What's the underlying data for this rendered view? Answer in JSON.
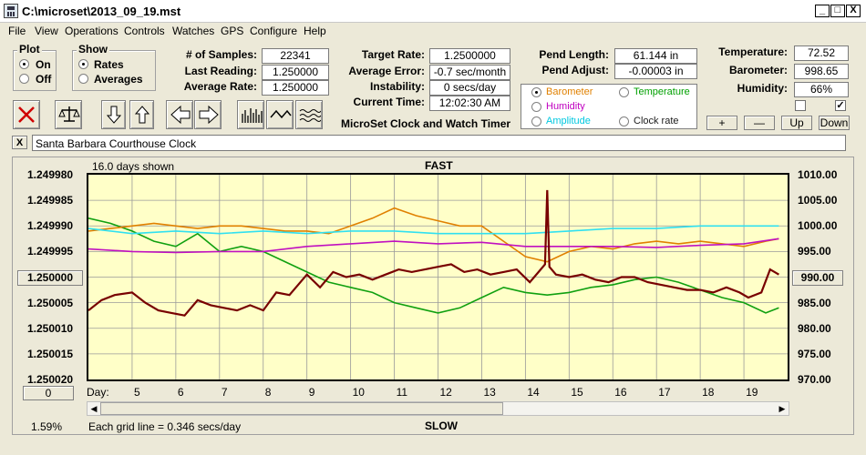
{
  "window": {
    "title": "C:\\microset\\2013_09_19.mst",
    "min": "_",
    "max": "□",
    "close": "X"
  },
  "menu": [
    "File",
    "View",
    "Operations",
    "Controls",
    "Watches",
    "GPS",
    "Configure",
    "Help"
  ],
  "plot_group": {
    "title": "Plot",
    "options": [
      "On",
      "Off"
    ],
    "selected": "On"
  },
  "show_group": {
    "title": "Show",
    "options": [
      "Rates",
      "Averages"
    ],
    "selected": "Rates"
  },
  "stats1": [
    {
      "label": "# of Samples:",
      "value": "22341"
    },
    {
      "label": "Last Reading:",
      "value": "1.250000"
    },
    {
      "label": "Average Rate:",
      "value": "1.250000"
    }
  ],
  "stats2": [
    {
      "label": "Target Rate:",
      "value": "1.2500000"
    },
    {
      "label": "Average Error:",
      "value": "-0.7 sec/month"
    },
    {
      "label": "Instability:",
      "value": "0 secs/day"
    },
    {
      "label": "Current Time:",
      "value": "12:02:30 AM"
    }
  ],
  "app_caption": "MicroSet Clock and Watch Timer",
  "stats3": [
    {
      "label": "Pend Length:",
      "value": "61.144 in"
    },
    {
      "label": "Pend Adjust:",
      "value": "-0.00003 in"
    }
  ],
  "stats4": [
    {
      "label": "Temperature:",
      "value": "72.52"
    },
    {
      "label": "Barometer:",
      "value": "998.65"
    },
    {
      "label": "Humidity:",
      "value": "66%"
    }
  ],
  "sensor_options": [
    {
      "label": "Barometer",
      "color": "#e08000",
      "selected": true
    },
    {
      "label": "Temperature",
      "color": "#00a000",
      "selected": false
    },
    {
      "label": "Humidity",
      "color": "#c000c0",
      "selected": false
    },
    {
      "label": "Clock rate",
      "color": "#202020",
      "selected": false
    },
    {
      "label": "Amplitude",
      "color": "#00c8e0",
      "selected": false
    }
  ],
  "axis_buttons": [
    "+",
    "—",
    "Up",
    "Down"
  ],
  "checkbox2": "✓",
  "watch_name": "Santa Barbara Courthouse Clock",
  "watch_close": "X",
  "chart_header": {
    "days_shown": "16.0 days shown",
    "top": "FAST",
    "bottom": "SLOW",
    "grid_note": "Each grid line = 0.346 secs/day",
    "percent": "1.59%",
    "day_label": "Day:",
    "center_left": "1.250000",
    "center_right": "990.00",
    "zero_btn": "0"
  },
  "chart_data": {
    "type": "line",
    "y_left_ticks": [
      "1.249980",
      "1.249985",
      "1.249990",
      "1.249995",
      "1.250000",
      "1.250005",
      "1.250010",
      "1.250015",
      "1.250020"
    ],
    "y_right_ticks": [
      "1010.00",
      "1005.00",
      "1000.00",
      "995.00",
      "990.00",
      "985.00",
      "980.00",
      "975.00",
      "970.00"
    ],
    "x_ticks": [
      "5",
      "6",
      "7",
      "8",
      "9",
      "10",
      "11",
      "12",
      "13",
      "14",
      "15",
      "16",
      "17",
      "18",
      "19"
    ],
    "xlim": [
      4.0,
      20.0
    ],
    "ylim_right": [
      970,
      1010
    ],
    "series": [
      {
        "name": "Temperature",
        "color": "#10a010",
        "x": [
          4.0,
          4.5,
          5.0,
          5.5,
          6.0,
          6.5,
          7.0,
          7.5,
          8.0,
          8.5,
          9.0,
          9.5,
          10.0,
          10.5,
          11.0,
          11.5,
          12.0,
          12.5,
          13.0,
          13.5,
          14.0,
          14.5,
          15.0,
          15.5,
          16.0,
          16.5,
          17.0,
          17.5,
          18.0,
          18.5,
          19.0,
          19.5,
          19.8
        ],
        "y": [
          1001.5,
          1000.5,
          999,
          997,
          996,
          998.5,
          995,
          996,
          995,
          993,
          991,
          989,
          988,
          987,
          985,
          984,
          983,
          984,
          986,
          988,
          987,
          986.5,
          987,
          988,
          988.5,
          989.5,
          990,
          989,
          987.5,
          986,
          985,
          983,
          984
        ]
      },
      {
        "name": "Barometer",
        "color": "#e08000",
        "x": [
          4.0,
          4.5,
          5.0,
          5.5,
          6.0,
          6.5,
          7.0,
          7.5,
          8.0,
          8.5,
          9.0,
          9.5,
          10.0,
          10.5,
          11.0,
          11.5,
          12.0,
          12.5,
          13.0,
          13.5,
          14.0,
          14.5,
          15.0,
          15.5,
          16.0,
          16.5,
          17.0,
          17.5,
          18.0,
          18.5,
          19.0,
          19.5,
          19.8
        ],
        "y": [
          999,
          999.5,
          1000,
          1000.5,
          1000,
          999.5,
          1000,
          1000,
          999.5,
          999,
          999,
          998.5,
          1000,
          1001.5,
          1003.5,
          1002,
          1001,
          1000,
          1000,
          997,
          994,
          993,
          995,
          996,
          995.5,
          996.5,
          997,
          996.5,
          997,
          996.5,
          996,
          997,
          997.5
        ]
      },
      {
        "name": "Amplitude",
        "color": "#30e0f0",
        "x": [
          4.0,
          5.0,
          6.0,
          7.0,
          8.0,
          9.0,
          10.0,
          11.0,
          12.0,
          13.0,
          14.0,
          15.0,
          16.0,
          17.0,
          18.0,
          19.0,
          19.8
        ],
        "y": [
          999.5,
          998.5,
          999,
          998.5,
          999,
          998.5,
          999,
          999,
          998.5,
          998.5,
          998.5,
          999,
          999.5,
          999.5,
          1000,
          1000,
          1000
        ]
      },
      {
        "name": "Humidity",
        "color": "#c010c0",
        "x": [
          4.0,
          5.0,
          6.0,
          7.0,
          8.0,
          9.0,
          10.0,
          11.0,
          12.0,
          13.0,
          14.0,
          15.0,
          16.0,
          17.0,
          18.0,
          19.0,
          19.8
        ],
        "y": [
          995.5,
          995,
          994.8,
          995,
          995,
          996,
          996.5,
          997,
          996.5,
          996.8,
          996,
          996,
          996,
          995.8,
          996.2,
          996.5,
          997.5
        ]
      },
      {
        "name": "Clock rate",
        "color": "#780000",
        "x": [
          4.0,
          4.3,
          4.6,
          5.0,
          5.3,
          5.6,
          5.9,
          6.2,
          6.5,
          6.8,
          7.1,
          7.4,
          7.7,
          8.0,
          8.3,
          8.6,
          9.0,
          9.3,
          9.6,
          9.9,
          10.2,
          10.5,
          10.8,
          11.1,
          11.4,
          11.7,
          12.0,
          12.3,
          12.6,
          12.9,
          13.2,
          13.5,
          13.8,
          14.1,
          14.3,
          14.45,
          14.5,
          14.55,
          14.7,
          15.0,
          15.3,
          15.6,
          15.9,
          16.2,
          16.5,
          16.8,
          17.1,
          17.4,
          17.7,
          18.0,
          18.3,
          18.6,
          18.9,
          19.1,
          19.4,
          19.6,
          19.8
        ],
        "y": [
          983.5,
          985.5,
          986.5,
          987,
          985,
          983.5,
          983,
          982.5,
          985.5,
          984.5,
          984,
          983.5,
          984.5,
          983.5,
          987,
          986.5,
          990.5,
          988,
          991,
          990,
          990.5,
          989.5,
          990.5,
          991.5,
          991,
          991.5,
          992,
          992.5,
          991,
          991.5,
          990.5,
          991,
          991.5,
          989,
          991,
          992.5,
          1007,
          992,
          990.5,
          990,
          990.5,
          989.5,
          989,
          990,
          990,
          989,
          988.5,
          988,
          987.5,
          987.5,
          987,
          988,
          987,
          986,
          987,
          991.5,
          990.5
        ]
      }
    ]
  }
}
